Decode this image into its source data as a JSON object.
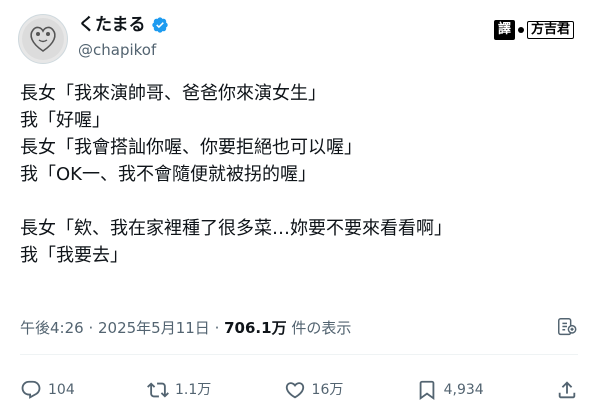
{
  "author": {
    "display_name": "くたまる",
    "handle": "@chapikof",
    "verified_icon": "verified-badge-icon",
    "avatar_icon": "avatar"
  },
  "watermark": {
    "badge": "譯",
    "name": "方吉君"
  },
  "tweet": {
    "lines": [
      "長女「我來演帥哥、爸爸你來演女生」",
      "我「好喔」",
      "長女「我會搭訕你喔、你要拒絕也可以喔」",
      "我「OK一、我不會隨便就被拐的喔」",
      "",
      "長女「欸、我在家裡種了很多菜…妳要不要來看看啊」",
      "我「我要去」"
    ]
  },
  "meta": {
    "time": "午後4:26",
    "separator": " · ",
    "date": "2025年5月11日",
    "views_count": "706.1万",
    "views_label": " 件の表示"
  },
  "actions": {
    "replies": "104",
    "reposts": "1.1万",
    "likes": "16万",
    "bookmarks": "4,934"
  },
  "colors": {
    "text_primary": "#0f1419",
    "text_secondary": "#536471",
    "verified_blue": "#1d9bf0",
    "divider": "#eff3f4"
  }
}
